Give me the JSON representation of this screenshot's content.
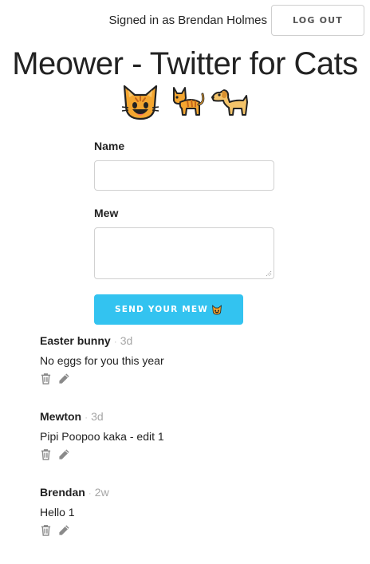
{
  "header": {
    "signed_in_text": "Signed in as Brendan Holmes",
    "logout_label": "LOG OUT"
  },
  "title": "Meower - Twitter for Cats",
  "title_emojis": [
    "cat-face-icon",
    "cat-icon",
    "dog-icon"
  ],
  "form": {
    "name_label": "Name",
    "name_value": "",
    "mew_label": "Mew",
    "mew_value": "",
    "send_label": "SEND YOUR MEW",
    "send_icon": "cat-face-icon"
  },
  "mews": [
    {
      "name": "Easter bunny",
      "separator": "·",
      "time": "3d",
      "text": "No eggs for you this year"
    },
    {
      "name": "Mewton",
      "separator": "·",
      "time": "3d",
      "text": "Pipi Poopoo kaka - edit 1"
    },
    {
      "name": "Brendan",
      "separator": "·",
      "time": "2w",
      "text": "Hello 1"
    }
  ],
  "colors": {
    "accent": "#33c3f0",
    "muted_time": "#a6a6a6",
    "icon_gray": "#8a8a8a",
    "emoji_orange": "#f4a630"
  }
}
